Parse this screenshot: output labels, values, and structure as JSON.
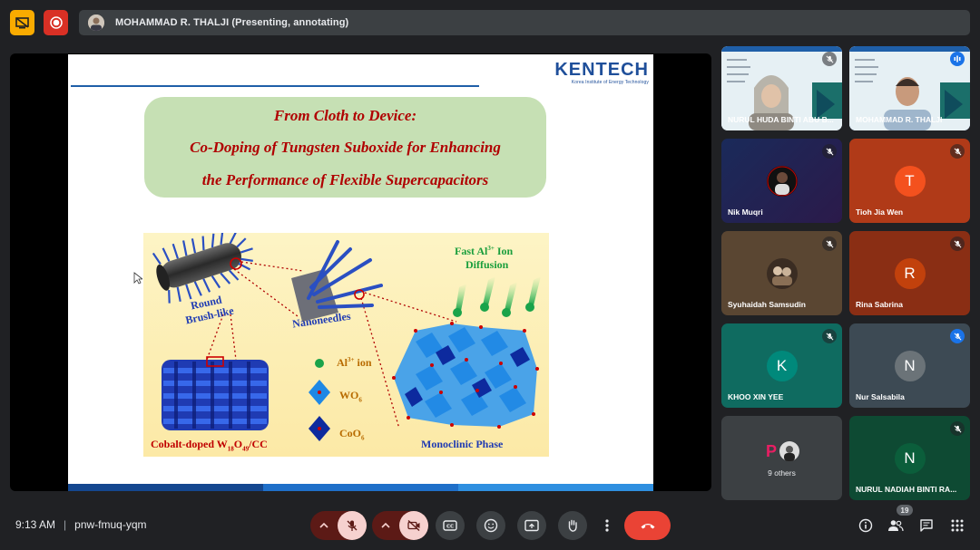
{
  "presenter_bar": {
    "label": "MOHAMMAD R. THALJI (Presenting, annotating)"
  },
  "slide": {
    "logo_brand": "KENTECH",
    "logo_sub": "Korea Institute of Energy Technology",
    "title_line1": "From Cloth to Device:",
    "title_line2": "Co-Doping of Tungsten Suboxide for Enhancing",
    "title_line3": "the Performance of Flexible Supercapacitors",
    "fig_fast_ion_a": "Fast Al",
    "fig_fast_ion_sup": "3+",
    "fig_fast_ion_b": " Ion",
    "fig_diffusion": "Diffusion",
    "fig_round": "Round",
    "fig_brush": "Brush-like",
    "fig_nanoneedles": "Nanoneedles",
    "legend_al_a": "Al",
    "legend_al_sup": "3+",
    "legend_al_b": " ion",
    "legend_wo6_a": "WO",
    "legend_wo6_sub": "6",
    "legend_coo6_a": "CoO",
    "legend_coo6_sub": "6",
    "fig_cobalt_a": "Cobalt-doped W",
    "fig_cobalt_sub1": "18",
    "fig_cobalt_o": "O",
    "fig_cobalt_sub2": "49",
    "fig_cobalt_b": "/CC",
    "fig_monoclinic": "Monoclinic Phase"
  },
  "participants": [
    {
      "name": "NURUL HUDA BINTI ABU B...",
      "muted": true,
      "type": "video"
    },
    {
      "name": "MOHAMMAD R. THALJI",
      "muted": false,
      "type": "video"
    },
    {
      "name": "Nik Muqri",
      "muted": true,
      "type": "avatar-image"
    },
    {
      "name": "Tioh Jia Wen",
      "muted": true,
      "type": "initial",
      "initial": "T",
      "color": "#f4511e"
    },
    {
      "name": "Syuhaidah Samsudin",
      "muted": true,
      "type": "avatar-image"
    },
    {
      "name": "Rina Sabrina",
      "muted": true,
      "type": "initial",
      "initial": "R",
      "color": "#c2410c"
    },
    {
      "name": "KHOO XIN YEE",
      "muted": true,
      "type": "initial",
      "initial": "K",
      "color": "#00897b"
    },
    {
      "name": "Nur Salsabila",
      "muted": true,
      "type": "initial",
      "initial": "N",
      "color": "#5f6368"
    },
    {
      "name": "9 others",
      "muted": false,
      "type": "others",
      "initial": "P"
    },
    {
      "name": "NURUL NADIAH BINTI RA...",
      "muted": true,
      "type": "initial",
      "initial": "N",
      "color": "#0b5e3b"
    }
  ],
  "meeting": {
    "time": "9:13 AM",
    "code": "pnw-fmuq-yqm",
    "participant_count": "19"
  },
  "colors": {
    "background": "#202124",
    "end_call": "#ea4335",
    "muted_control": "#f6d1cf",
    "slide_title": "#b00000",
    "title_box": "#c6e0b4"
  }
}
